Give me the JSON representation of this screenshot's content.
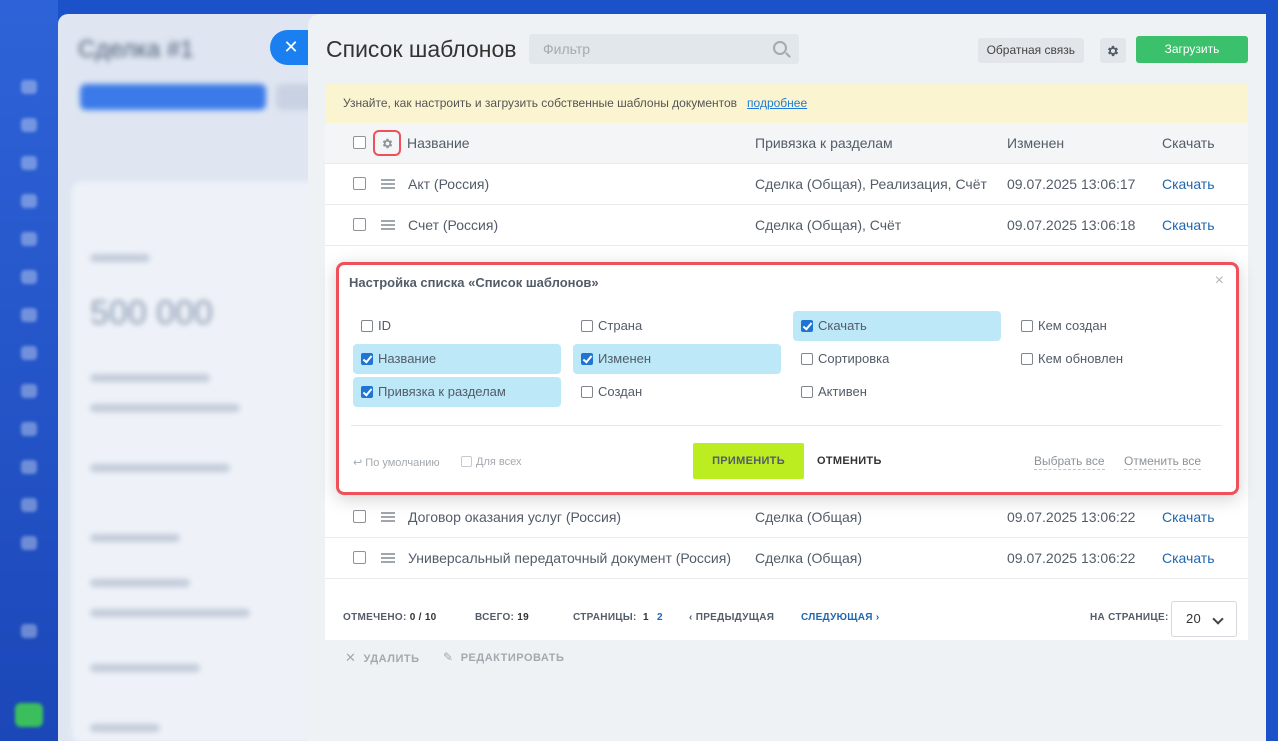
{
  "background": {
    "crm_title": "Сделка #1",
    "crm_amount": "500 000"
  },
  "panel": {
    "title": "Список шаблонов",
    "filter_placeholder": "Фильтр",
    "feedback_label": "Обратная связь",
    "upload_label": "Загрузить"
  },
  "info": {
    "text": "Узнайте, как настроить и загрузить собственные шаблоны документов",
    "link": "подробнее"
  },
  "grid": {
    "columns": [
      "Название",
      "Привязка к разделам",
      "Изменен",
      "Скачать"
    ],
    "rows": [
      {
        "name": "Акт (Россия)",
        "binding": "Сделка (Общая), Реализация, Счёт",
        "modified": "09.07.2025 13:06:17",
        "download": "Скачать"
      },
      {
        "name": "Счет (Россия)",
        "binding": "Сделка (Общая), Счёт",
        "modified": "09.07.2025 13:06:18",
        "download": "Скачать"
      },
      {
        "name": "Договор оказания услуг (Россия)",
        "binding": "Сделка (Общая)",
        "modified": "09.07.2025 13:06:22",
        "download": "Скачать"
      },
      {
        "name": "Универсальный передаточный документ (Россия)",
        "binding": "Сделка (Общая)",
        "modified": "09.07.2025 13:06:22",
        "download": "Скачать"
      }
    ]
  },
  "footer": {
    "marked_label": "ОТМЕЧЕНО:",
    "marked_value": "0 / 10",
    "total_label": "ВСЕГО:",
    "total_value": "19",
    "pages_label": "СТРАНИЦЫ:",
    "page1": "1",
    "page2": "2",
    "prev": "ПРЕДЫДУЩАЯ",
    "next": "СЛЕДУЮЩАЯ",
    "per_page_label": "НА СТРАНИЦЕ:",
    "per_page_value": "20"
  },
  "actions": {
    "delete": "УДАЛИТЬ",
    "edit": "РЕДАКТИРОВАТЬ"
  },
  "popup": {
    "title": "Настройка списка «Список шаблонов»",
    "options": [
      {
        "label": "ID",
        "checked": false
      },
      {
        "label": "Страна",
        "checked": false
      },
      {
        "label": "Скачать",
        "checked": true
      },
      {
        "label": "Кем создан",
        "checked": false
      },
      {
        "label": "Название",
        "checked": true
      },
      {
        "label": "Изменен",
        "checked": true
      },
      {
        "label": "Сортировка",
        "checked": false
      },
      {
        "label": "Кем обновлен",
        "checked": false
      },
      {
        "label": "Привязка к разделам",
        "checked": true
      },
      {
        "label": "Создан",
        "checked": false
      },
      {
        "label": "Активен",
        "checked": false
      }
    ],
    "default_label": "По умолчанию",
    "for_all_label": "Для всех",
    "apply_label": "ПРИМЕНИТЬ",
    "cancel_label": "ОТМЕНИТЬ",
    "select_all_label": "Выбрать все",
    "deselect_all_label": "Отменить все"
  }
}
